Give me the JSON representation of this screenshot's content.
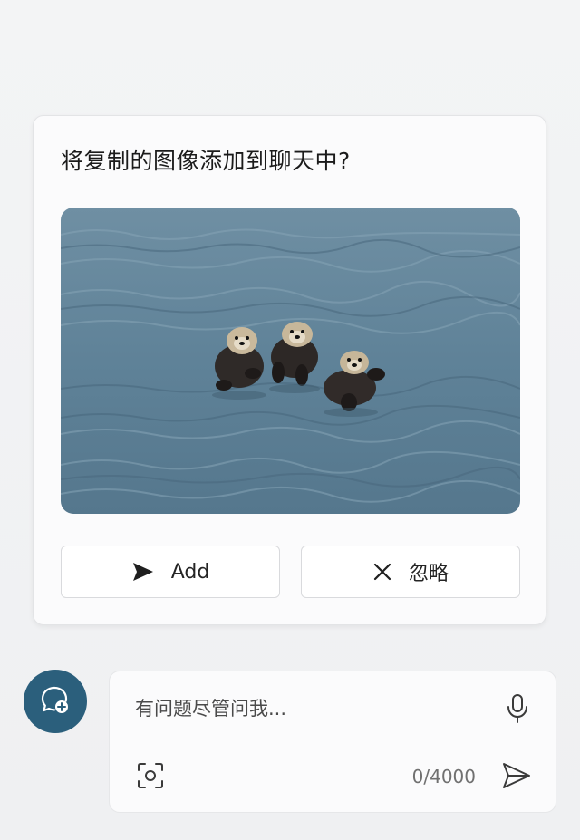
{
  "dialog": {
    "title": "将复制的图像添加到聊天中?",
    "preview_icon": "pasted-image-otters",
    "add_label": "Add",
    "ignore_label": "忽略"
  },
  "composer": {
    "placeholder": "有问题尽管问我...",
    "counter": "0/4000"
  },
  "icons": {
    "add": "send-arrow-icon",
    "ignore": "close-icon",
    "new_chat": "new-chat-icon",
    "mic": "microphone-icon",
    "capture": "screenshot-capture-icon",
    "send": "send-icon"
  },
  "colors": {
    "accent": "#2b5f7c",
    "card_bg": "#fbfbfc",
    "page_bg": "#f1f2f3"
  }
}
